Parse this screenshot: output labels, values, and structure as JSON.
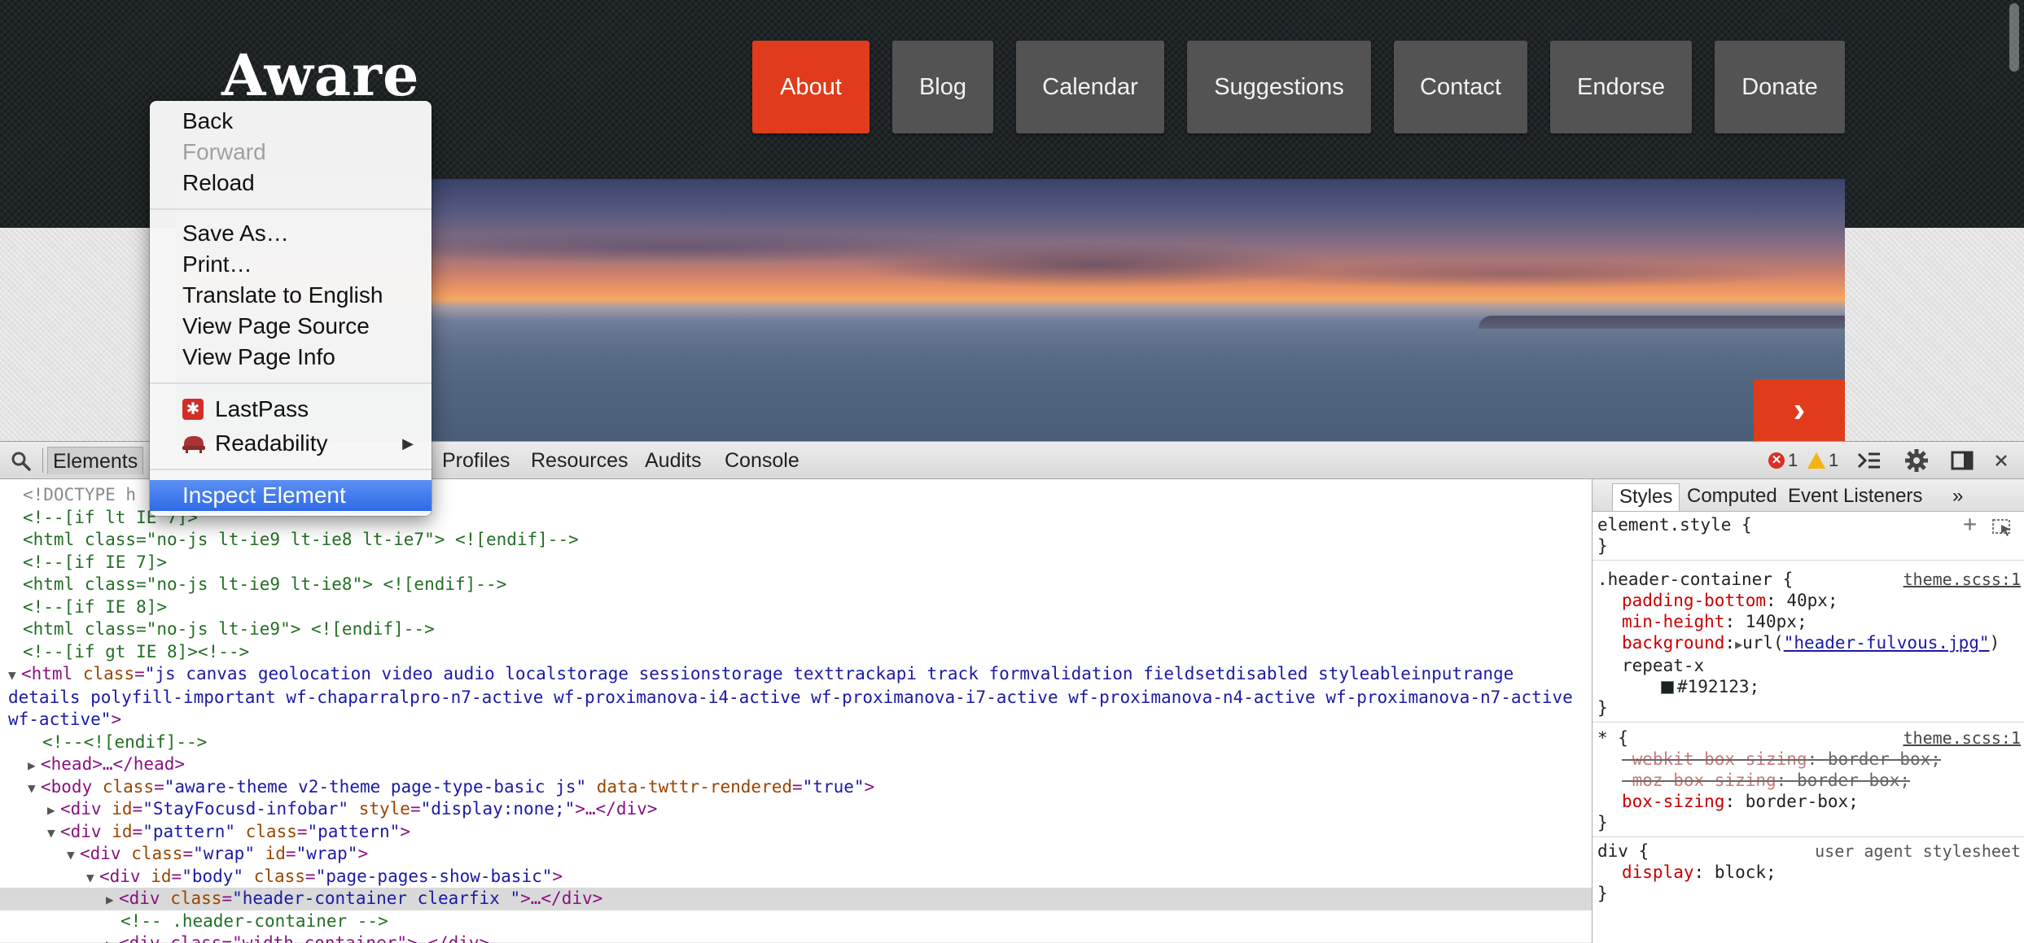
{
  "site": {
    "logo": "Aware",
    "nav": [
      {
        "label": "About",
        "active": true
      },
      {
        "label": "Blog",
        "active": false
      },
      {
        "label": "Calendar",
        "active": false
      },
      {
        "label": "Suggestions",
        "active": false
      },
      {
        "label": "Contact",
        "active": false
      },
      {
        "label": "Endorse",
        "active": false
      },
      {
        "label": "Donate",
        "active": false
      }
    ],
    "banner_next": "›",
    "colors": {
      "accent": "#e03c1b",
      "nav_bg": "#535353",
      "header_bg": "#1f2426"
    }
  },
  "context_menu": {
    "items": {
      "back": "Back",
      "forward": "Forward",
      "reload": "Reload",
      "save_as": "Save As…",
      "print": "Print…",
      "translate": "Translate to English",
      "view_source": "View Page Source",
      "view_info": "View Page Info",
      "lastpass": "LastPass",
      "readability": "Readability",
      "inspect": "Inspect Element"
    },
    "submenu_arrow": "▶"
  },
  "devtools": {
    "tabs": {
      "elements": "Elements",
      "profiles": "Profiles",
      "resources": "Resources",
      "audits": "Audits",
      "console": "Console"
    },
    "errors": "1",
    "warnings": "1",
    "dom": {
      "l1": "<!DOCTYPE h",
      "l2": "<!--[if lt IE 7]>",
      "l3": "<html class=\"no-js lt-ie9 lt-ie8 lt-ie7\"> <![endif]-->",
      "l4": "<!--[if IE 7]>",
      "l5": "<html class=\"no-js lt-ie9 lt-ie8\"> <![endif]-->",
      "l6": "<!--[if IE 8]>",
      "l7": "<html class=\"no-js lt-ie9\"> <![endif]-->",
      "l8": "<!--[if gt IE 8]><!-->",
      "html_tag_open": "<html",
      "html_class_attr": "class",
      "html_class_val": "\"js canvas geolocation video audio localstorage sessionstorage texttrackapi track formvalidation fieldsetdisabled styleableinputrange details polyfill-important wf-chaparralpro-n7-active wf-proximanova-i4-active wf-proximanova-i7-active wf-proximanova-n4-active wf-proximanova-n7-active wf-active\"",
      "html_tag_close": ">",
      "l10": "<!--<![endif]-->",
      "head": "<head>…</head>",
      "body_open": "<body",
      "body_class_attr": "class",
      "body_class_val": "\"aware-theme v2-theme page-type-basic js\"",
      "body_data_attr": "data-twttr-rendered",
      "body_data_val": "\"true\"",
      "gt": ">",
      "div1_open": "<div",
      "div1_id_attr": "id",
      "div1_id_val": "\"StayFocusd-infobar\"",
      "div1_style_attr": "style",
      "div1_style_val": "\"display:none;\"",
      "div1_close": ">…</div>",
      "div2_open": "<div",
      "div2_id_attr": "id",
      "div2_id_val": "\"pattern\"",
      "div2_class_attr": "class",
      "div2_class_val": "\"pattern\"",
      "div3_open": "<div",
      "div3_class_attr": "class",
      "div3_class_val": "\"wrap\"",
      "div3_id_attr": "id",
      "div3_id_val": "\"wrap\"",
      "div4_open": "<div",
      "div4_id_attr": "id",
      "div4_id_val": "\"body\"",
      "div4_class_attr": "class",
      "div4_class_val": "\"page-pages-show-basic\"",
      "div5_open": "<div",
      "div5_class_attr": "class",
      "div5_class_val": "\"header-container clearfix \"",
      "div5_close": ">…</div>",
      "comment_hc": "<!-- .header-container -->",
      "partial": "<div class=\"width-container\">…</div>"
    },
    "styles": {
      "tabs": {
        "styles": "Styles",
        "computed": "Computed",
        "event_listeners": "Event Listeners",
        "more": "»"
      },
      "element_style": "element.style {",
      "close_brace": "}",
      "hc_selector": ".header-container {",
      "hc_source": "theme.scss:1",
      "padding_bottom_name": "padding-bottom",
      "padding_bottom_val": "40px;",
      "min_height_name": "min-height",
      "min_height_val": "140px;",
      "background_name": "background",
      "background_url_prefix": "url(",
      "background_url": "\"header-fulvous.jpg\"",
      "background_repeat": ") repeat-x",
      "background_color": "#192123;",
      "star_selector": "* {",
      "star_source": "theme.scss:1",
      "webkit_box_name": "-webkit-box-sizing",
      "moz_box_name": "-moz-box-sizing",
      "box_sizing_name": "box-sizing",
      "box_val": "border-box;",
      "div_selector": "div {",
      "div_source": "user agent stylesheet",
      "display_name": "display",
      "display_val": "block;"
    }
  }
}
